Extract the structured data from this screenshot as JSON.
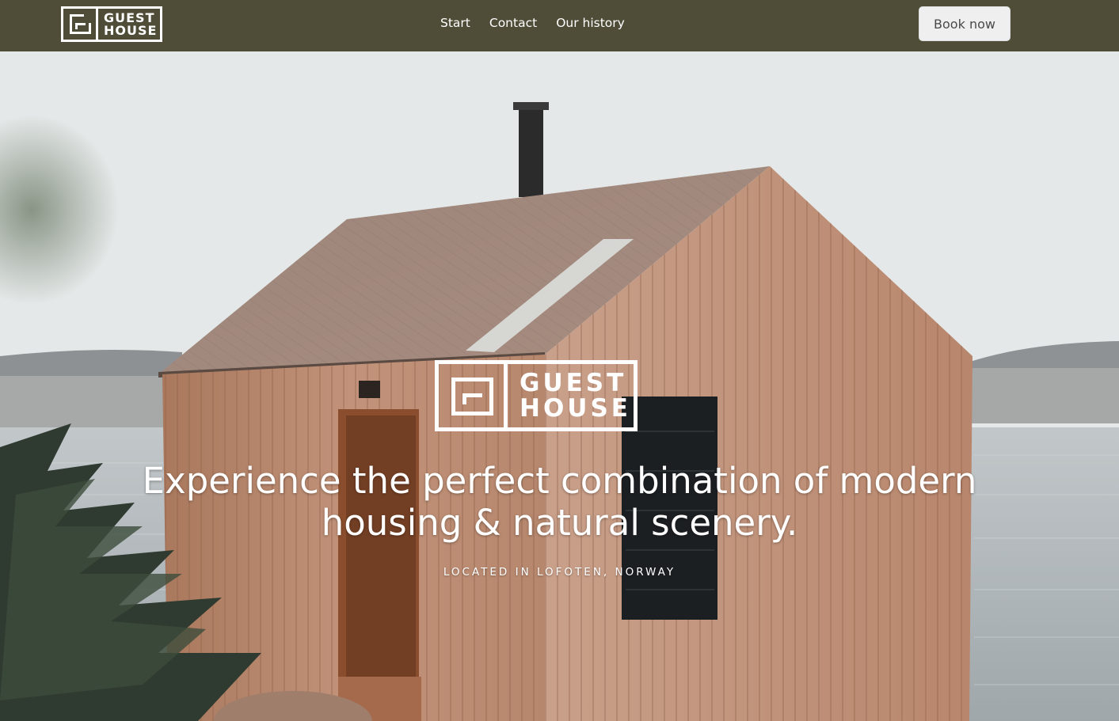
{
  "header": {
    "logo": {
      "line1": "GUEST",
      "line2": "HOUSE"
    },
    "nav": [
      {
        "label": "Start"
      },
      {
        "label": "Contact"
      },
      {
        "label": "Our history"
      }
    ],
    "book_button": "Book now"
  },
  "hero": {
    "logo": {
      "line1": "GUEST",
      "line2": "HOUSE"
    },
    "headline_line1": "Experience the perfect combination of modern",
    "headline_line2": "housing & natural scenery.",
    "tagline": "LOCATED IN LOFOTEN, NORWAY"
  },
  "colors": {
    "header_bg": "#4f4c37",
    "button_bg": "#efefef",
    "text_light": "#ffffff"
  }
}
